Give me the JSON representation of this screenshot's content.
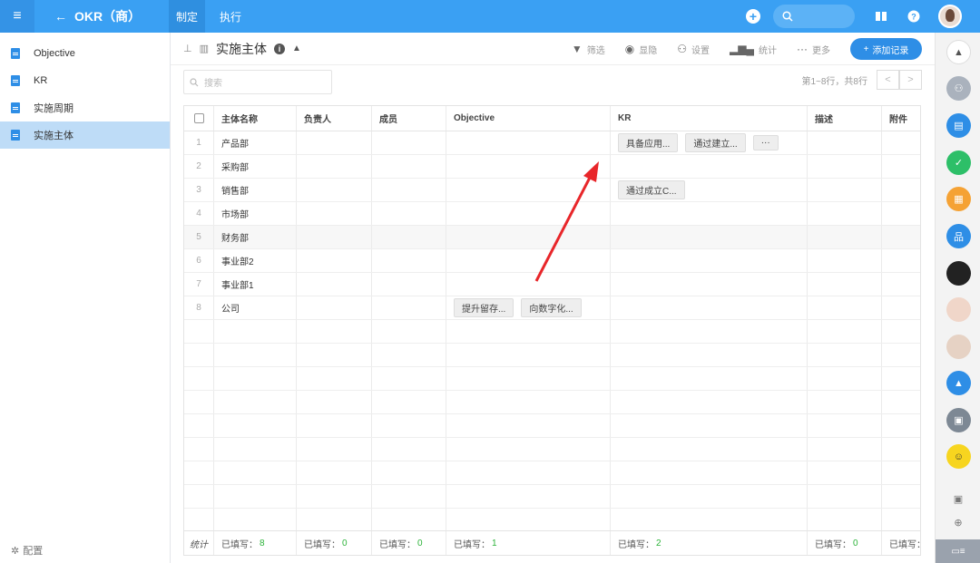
{
  "app": {
    "title": "OKR（商）",
    "tabs": [
      "制定",
      "执行"
    ],
    "active_tab": 0
  },
  "sidebar": {
    "items": [
      {
        "label": "Objective",
        "active": false
      },
      {
        "label": "KR",
        "active": false
      },
      {
        "label": "实施周期",
        "active": false
      },
      {
        "label": "实施主体",
        "active": true
      }
    ],
    "config_label": "配置"
  },
  "toolbar": {
    "title": "实施主体",
    "actions": {
      "filter": "筛选",
      "show_hide": "显隐",
      "settings": "设置",
      "stats": "统计",
      "more": "更多"
    },
    "add_label": "添加记录"
  },
  "search": {
    "placeholder": "搜索"
  },
  "pager": {
    "text": "第1~8行，共8行",
    "prev": "<",
    "next": ">"
  },
  "table": {
    "columns": [
      "主体名称",
      "负责人",
      "成员",
      "Objective",
      "KR",
      "描述",
      "附件"
    ],
    "rows": [
      {
        "index": "1",
        "name": "产品部",
        "objective": [],
        "kr": [
          "具备应用...",
          "通过建立...",
          "···"
        ]
      },
      {
        "index": "2",
        "name": "采购部",
        "objective": [],
        "kr": []
      },
      {
        "index": "3",
        "name": "销售部",
        "objective": [],
        "kr": [
          "通过成立C..."
        ]
      },
      {
        "index": "4",
        "name": "市场部",
        "objective": [],
        "kr": []
      },
      {
        "index": "5",
        "name": "财务部",
        "objective": [],
        "kr": []
      },
      {
        "index": "6",
        "name": "事业部2",
        "objective": [],
        "kr": []
      },
      {
        "index": "7",
        "name": "事业部1",
        "objective": [],
        "kr": []
      },
      {
        "index": "8",
        "name": "公司",
        "objective": [
          "提升留存...",
          "向数字化..."
        ],
        "kr": []
      }
    ],
    "footer": {
      "stat_label": "统计",
      "filled_label": "已填写：",
      "counts": [
        "8",
        "0",
        "0",
        "1",
        "2",
        "0",
        ""
      ]
    }
  },
  "colors": {
    "topbar": "#3aa0f3",
    "accent": "#2e8ee6",
    "arrow": "#e8262a",
    "filled_count": "#2db33a"
  },
  "rail_icons": [
    "bell-icon",
    "group-avatar-icon",
    "chat-icon",
    "check-icon",
    "grid-icon",
    "org-chart-icon",
    "avatar",
    "avatar",
    "group-avatar",
    "bell-icon",
    "briefcase-icon",
    "smiley-icon",
    "contact-icon",
    "add-icon",
    "card-icon"
  ]
}
